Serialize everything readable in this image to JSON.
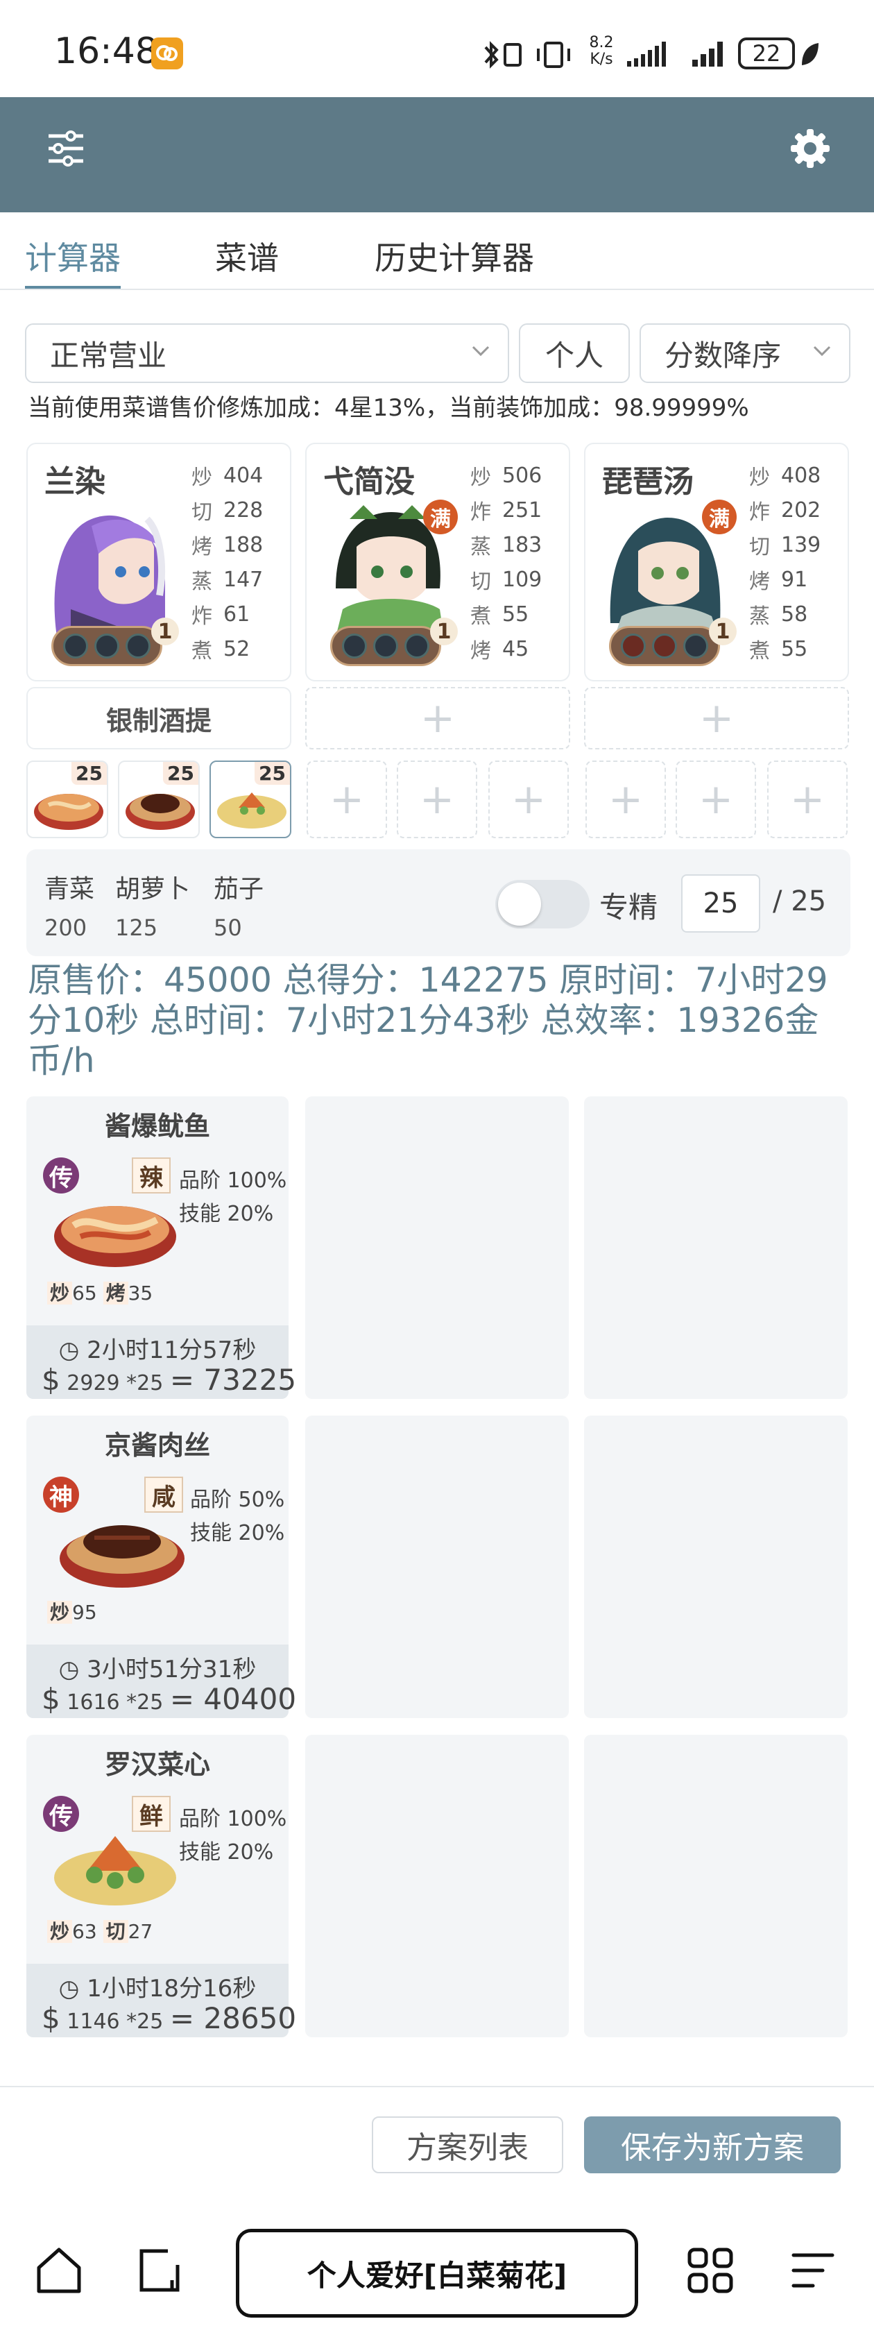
{
  "status_bar": {
    "time": "16:48",
    "net_speed_value": "8.2",
    "net_speed_unit": "K/s",
    "battery": "22"
  },
  "colors": {
    "accent": "#5e8aa0",
    "app_bar": "#5e7a87",
    "summary_text": "#5e7f8f",
    "primary_button": "#7d9cad",
    "rarity_chuan": "#7b3a76",
    "rarity_shen": "#c8402a"
  },
  "tabs": [
    {
      "label": "计算器",
      "active": true
    },
    {
      "label": "菜谱",
      "active": false
    },
    {
      "label": "历史计算器",
      "active": false
    }
  ],
  "filters": {
    "mode": "正常营业",
    "scope": "个人",
    "sort": "分数降序"
  },
  "bonus_note": "当前使用菜谱售价修炼加成：4星13%，当前装饰加成：98.99999%",
  "chefs": [
    {
      "name": "兰染",
      "full_badge": "",
      "level": "1",
      "stats": [
        {
          "k": "炒",
          "v": "404"
        },
        {
          "k": "切",
          "v": "228"
        },
        {
          "k": "烤",
          "v": "188"
        },
        {
          "k": "蒸",
          "v": "147"
        },
        {
          "k": "炸",
          "v": "61"
        },
        {
          "k": "煮",
          "v": "52"
        }
      ]
    },
    {
      "name": "弋简没",
      "full_badge": "满",
      "level": "1",
      "stats": [
        {
          "k": "炒",
          "v": "506"
        },
        {
          "k": "炸",
          "v": "251"
        },
        {
          "k": "蒸",
          "v": "183"
        },
        {
          "k": "切",
          "v": "109"
        },
        {
          "k": "煮",
          "v": "55"
        },
        {
          "k": "烤",
          "v": "45"
        }
      ]
    },
    {
      "name": "琵琶汤",
      "full_badge": "满",
      "level": "1",
      "stats": [
        {
          "k": "炒",
          "v": "408"
        },
        {
          "k": "炸",
          "v": "202"
        },
        {
          "k": "切",
          "v": "139"
        },
        {
          "k": "烤",
          "v": "91"
        },
        {
          "k": "蒸",
          "v": "58"
        },
        {
          "k": "煮",
          "v": "55"
        }
      ]
    }
  ],
  "equipment": {
    "chef1": "银制酒提"
  },
  "dish_slots": [
    {
      "qty": "25"
    },
    {
      "qty": "25"
    },
    {
      "qty": "25"
    }
  ],
  "ingredients": [
    {
      "name": "青菜",
      "qty": "200"
    },
    {
      "name": "胡萝卜",
      "qty": "125"
    },
    {
      "name": "茄子",
      "qty": "50"
    }
  ],
  "specialize": {
    "label": "专精",
    "value": "25",
    "max": "/ 25"
  },
  "summary": "原售价：45000 总得分：142275 原时间：7小时29分10秒 总时间：7小时21分43秒 总效率：19326金币/h",
  "recipes": [
    {
      "name": "酱爆鱿鱼",
      "rarity": "传",
      "flavor": "辣",
      "grade": "品阶 100%",
      "skill": "技能 20%",
      "reqs": [
        {
          "k": "炒",
          "v": "65"
        },
        {
          "k": "烤",
          "v": "35"
        }
      ],
      "time": "2小时11分57秒",
      "currency": "$",
      "price": "2929 *25",
      "total": "= 73225"
    },
    {
      "name": "京酱肉丝",
      "rarity": "神",
      "flavor": "咸",
      "grade": "品阶 50%",
      "skill": "技能 20%",
      "reqs": [
        {
          "k": "炒",
          "v": "95"
        }
      ],
      "time": "3小时51分31秒",
      "currency": "$",
      "price": "1616 *25",
      "total": "= 40400"
    },
    {
      "name": "罗汉菜心",
      "rarity": "传",
      "flavor": "鲜",
      "grade": "品阶 100%",
      "skill": "技能 20%",
      "reqs": [
        {
          "k": "炒",
          "v": "63"
        },
        {
          "k": "切",
          "v": "27"
        }
      ],
      "time": "1小时18分16秒",
      "currency": "$",
      "price": "1146 *25",
      "total": "= 28650"
    }
  ],
  "actions": {
    "list": "方案列表",
    "save": "保存为新方案"
  },
  "nav": {
    "center": "个人爱好[白菜菊花]"
  },
  "icons": [
    "sliders-icon",
    "gear-icon",
    "chevron-down-icon",
    "plus-icon",
    "clock-icon",
    "home-icon",
    "tabs-icon",
    "grid-icon",
    "menu-icon",
    "bluetooth-icon",
    "vibrate-icon",
    "signal-icon",
    "battery-icon"
  ]
}
